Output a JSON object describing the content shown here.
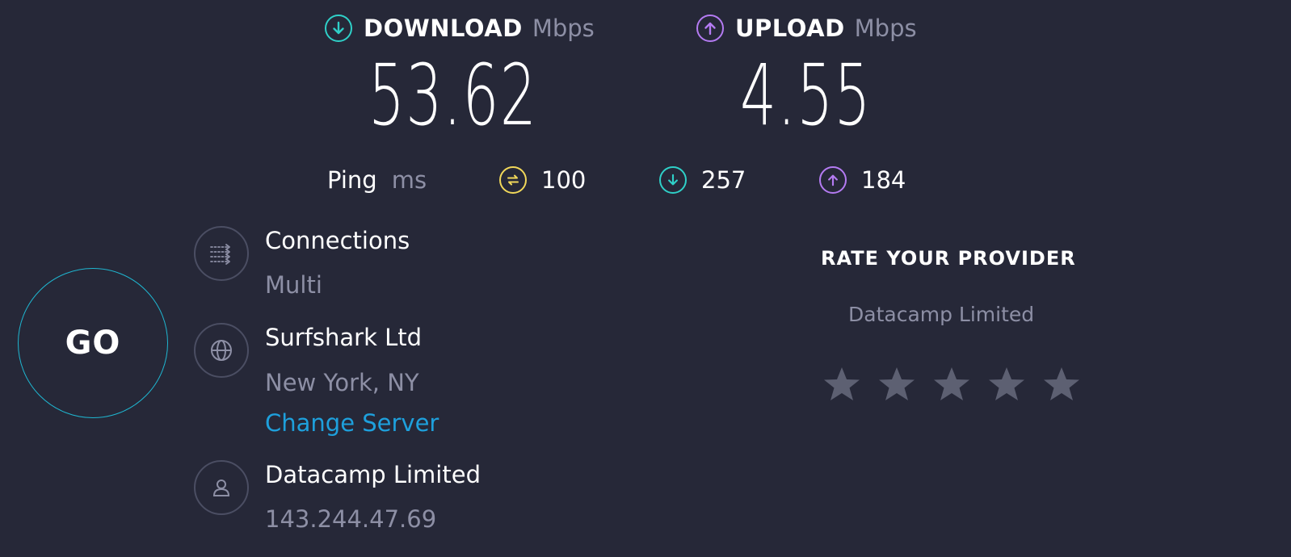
{
  "download": {
    "label": "DOWNLOAD",
    "unit": "Mbps",
    "value": "53.62",
    "color": "#2fd0c8"
  },
  "upload": {
    "label": "UPLOAD",
    "unit": "Mbps",
    "value": "4.55",
    "color": "#b47bf2"
  },
  "ping": {
    "label": "Ping",
    "unit": "ms",
    "idle": {
      "value": "100",
      "icon": "ping-idle-icon",
      "color": "#f1d85a"
    },
    "download": {
      "value": "257",
      "icon": "download-arrow-icon",
      "color": "#2fd0c8"
    },
    "upload": {
      "value": "184",
      "icon": "upload-arrow-icon",
      "color": "#b47bf2"
    }
  },
  "go_button": {
    "label": "GO",
    "ring_color": "#1fb6d0"
  },
  "connections": {
    "title": "Connections",
    "value": "Multi",
    "icon": "connections-icon"
  },
  "server": {
    "name": "Surfshark Ltd",
    "location": "New York, NY",
    "change_label": "Change Server",
    "icon": "globe-icon"
  },
  "isp": {
    "name": "Datacamp Limited",
    "ip": "143.244.47.69",
    "icon": "user-icon"
  },
  "rate": {
    "title": "RATE YOUR PROVIDER",
    "provider": "Datacamp Limited",
    "stars_total": 5,
    "stars_filled": 0,
    "star_color": "#5d6072"
  }
}
